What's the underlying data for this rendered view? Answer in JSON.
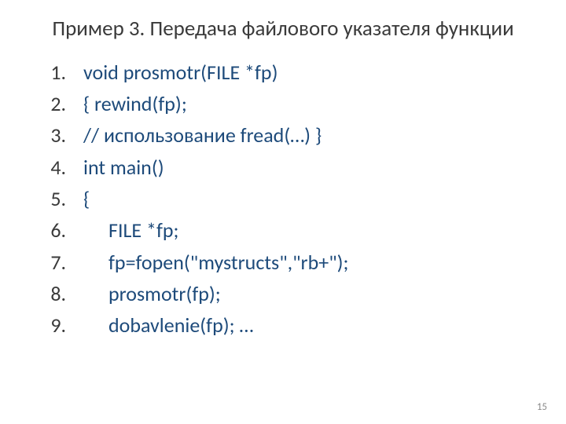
{
  "title": "Пример 3.  Передача файлового указателя функции",
  "lines": [
    "void prosmotr(FILE *fp)",
    "{    rewind(fp);",
    "// использование fread(…)     }",
    "int main()",
    "{",
    "FILE *fp;",
    "fp=fopen(\"mystructs\",\"rb+\");",
    "prosmotr(fp);",
    "dobavlenie(fp); …"
  ],
  "indented": [
    false,
    false,
    false,
    false,
    false,
    true,
    true,
    true,
    true
  ],
  "page_number": "15"
}
